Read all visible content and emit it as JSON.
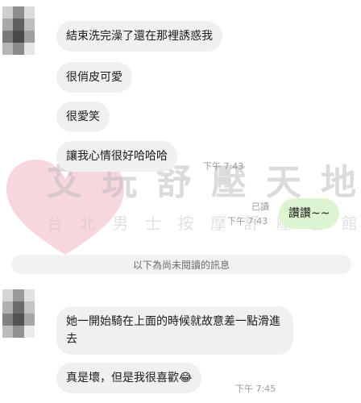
{
  "watermark": {
    "title_chars": [
      "艾",
      "玩",
      "舒",
      "壓",
      "天",
      "地"
    ],
    "subtitle_chars": [
      "台",
      "北",
      "男",
      "士",
      "按",
      "摩",
      "舒",
      "壓",
      "會",
      "館"
    ]
  },
  "messages_before": [
    {
      "text": "結束洗完澡了還在那裡誘惑我"
    },
    {
      "text": "很俏皮可愛"
    },
    {
      "text": "很愛笑"
    },
    {
      "text": "讓我心情很好哈哈哈",
      "time": "下午 7:43"
    }
  ],
  "my_message": {
    "text": "讚讚~~",
    "read_label": "已讀",
    "time": "下午 7:43"
  },
  "unread_divider": "以下為尚未閱讀的訊息",
  "messages_after": [
    {
      "text": "她一開始騎在上面的時候就故意差一點滑進去"
    },
    {
      "text": "真是壞，但是我很喜歡😂",
      "time": "下午 7:45"
    }
  ],
  "colors": {
    "bubble_other": "#f0f0f0",
    "bubble_mine": "#dcf5d0",
    "divider_bg": "#f2f2f2",
    "watermark_heart": "#f4c6d0"
  }
}
